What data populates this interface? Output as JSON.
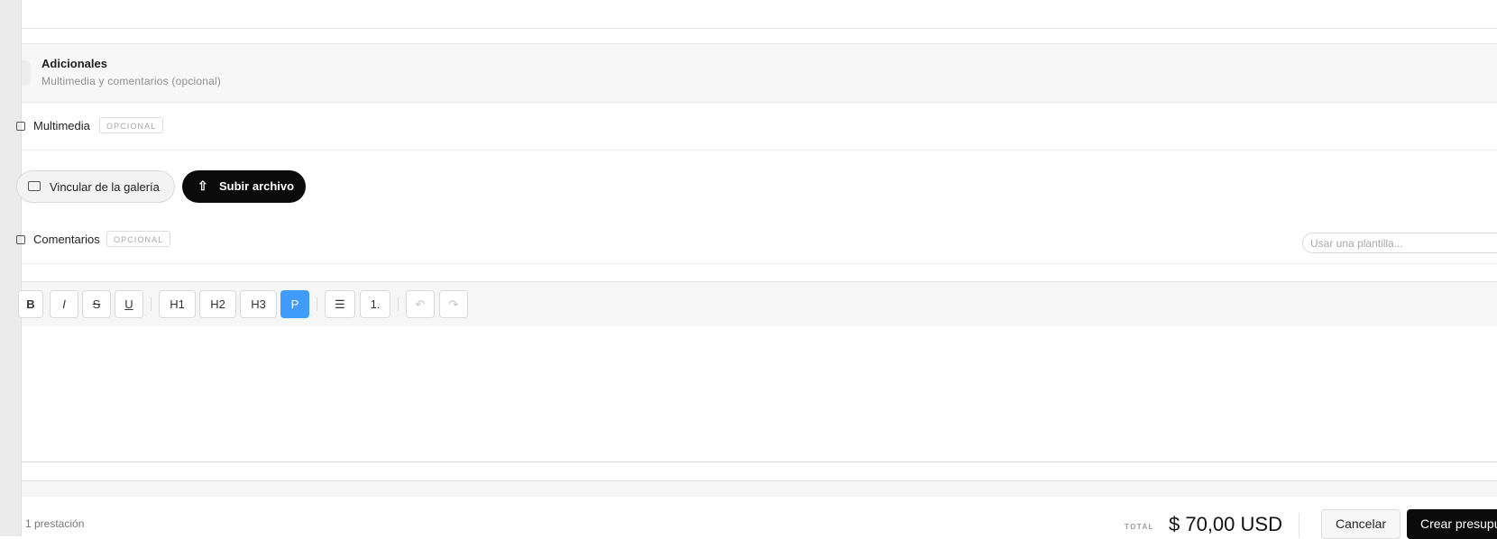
{
  "section": {
    "title": "Adicionales",
    "subtitle": "Multimedia y comentarios (opcional)"
  },
  "multimedia": {
    "label": "Multimedia",
    "badge": "OPCIONAL",
    "gallery_button": "Vincular de la galería",
    "upload_button": "Subir archivo",
    "upload_icon": "upload-icon",
    "gallery_icon": "image-icon"
  },
  "comments": {
    "label": "Comentarios",
    "badge": "OPCIONAL",
    "template_placeholder": "Usar una plantilla..."
  },
  "toolbar": {
    "bold": "B",
    "italic": "I",
    "strike": "S",
    "underline": "U",
    "h1": "H1",
    "h2": "H2",
    "h3": "H3",
    "paragraph": "P",
    "bullet_list": "☰",
    "ordered_list": "1.",
    "undo": "↶",
    "redo": "↷",
    "active_format": "P",
    "active_color": "#3f9cfb"
  },
  "footer": {
    "count": "1 prestación",
    "total_label": "TOTAL",
    "total_value": "$ 70,00 USD",
    "cancel": "Cancelar",
    "create": "Crear presupuesto"
  }
}
